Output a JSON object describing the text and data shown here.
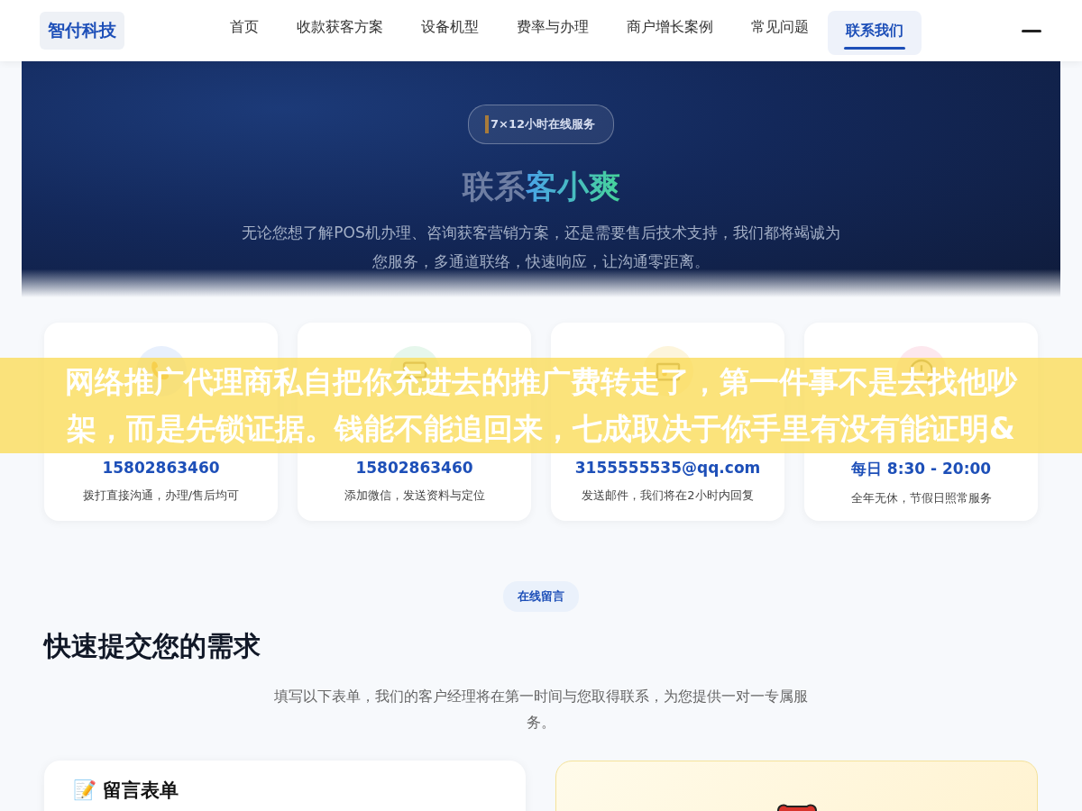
{
  "nav": {
    "logo": "智付科技",
    "items": [
      {
        "label": "首页",
        "selected": false
      },
      {
        "label": "收款获客方案",
        "selected": false
      },
      {
        "label": "设备机型",
        "selected": false
      },
      {
        "label": "费率与办理",
        "selected": false
      },
      {
        "label": "商户增长案例",
        "selected": false
      },
      {
        "label": "常见问题",
        "selected": false
      },
      {
        "label": "联系我们",
        "selected": true
      }
    ]
  },
  "hero": {
    "badge": "7×12小时在线服务",
    "title_plain": "联系",
    "title_highlight": "客小爽",
    "subtitle": "无论您想了解POS机办理、咨询获客营销方案，还是需要售后技术支持，我们都将竭诚为您服务，多通道联络，快速响应，让沟通零距离。"
  },
  "contact_cards": [
    {
      "kind": "phone",
      "value": "15802863460",
      "note": "拨打直接沟通，办理/售后均可"
    },
    {
      "kind": "chat",
      "value": "15802863460",
      "note": "添加微信，发送资料与定位"
    },
    {
      "kind": "mail",
      "value": "3155555535@qq.com",
      "note": "发送邮件，我们将在2小时内回复"
    },
    {
      "kind": "clock",
      "value": "每日 8:30 - 20:00",
      "note": "全年无休，节假日照常服务"
    }
  ],
  "overlay_banner": {
    "text": "网络推广代理商私自把你充进去的推广费转走了，第一件事不是去找他吵架，而是先锁证据。钱能不能追回来，七成取决于你手里有没有能证明&"
  },
  "message_section": {
    "badge": "在线留言",
    "heading": "快速提交您的需求",
    "description": "填写以下表单，我们的客户经理将在第一时间与您取得联系，为您提供一对一专属服务。",
    "form_card": {
      "title": "📝 留言表单"
    }
  }
}
